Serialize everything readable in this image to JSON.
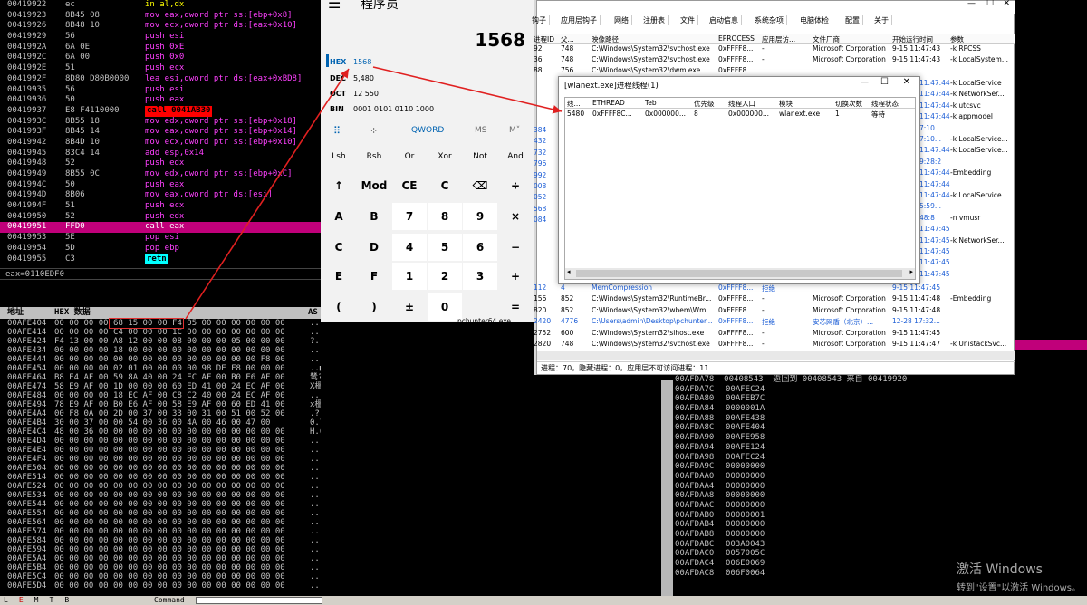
{
  "disasm": {
    "rows": [
      {
        "addr": "00419922",
        "hex": "ec",
        "mnem": "in al,dx",
        "color": "#ffff00"
      },
      {
        "addr": "00419923",
        "hex": "8B45 08",
        "mnem": "mov eax,dword ptr ss:[ebp+0x8]",
        "color": "#ff40ff"
      },
      {
        "addr": "00419926",
        "hex": "8B48 10",
        "mnem": "mov ecx,dword ptr ds:[eax+0x10]",
        "color": "#ff40ff"
      },
      {
        "addr": "00419929",
        "hex": "56",
        "mnem": "push esi",
        "color": "#ff40ff"
      },
      {
        "addr": "0041992A",
        "hex": "6A 0E",
        "mnem": "push 0xE",
        "color": "#ff40ff"
      },
      {
        "addr": "0041992C",
        "hex": "6A 00",
        "mnem": "push 0x0",
        "color": "#ff40ff"
      },
      {
        "addr": "0041992E",
        "hex": "51",
        "mnem": "push ecx",
        "color": "#ff40ff"
      },
      {
        "addr": "0041992F",
        "hex": "8D80 D80B0000",
        "mnem": "lea esi,dword ptr ds:[eax+0xBD8]",
        "color": "#ff40ff"
      },
      {
        "addr": "00419935",
        "hex": "56",
        "mnem": "push esi",
        "color": "#ff40ff"
      },
      {
        "addr": "00419936",
        "hex": "50",
        "mnem": "push eax",
        "color": "#ff40ff"
      },
      {
        "addr": "00419937",
        "hex": "E8 F4110000",
        "mnem": "call 0041AB30",
        "color": "#000000",
        "bg": "#ff0000"
      },
      {
        "addr": "0041993C",
        "hex": "8B55 18",
        "mnem": "mov edx,dword ptr ss:[ebp+0x18]",
        "color": "#ff40ff"
      },
      {
        "addr": "0041993F",
        "hex": "8B45 14",
        "mnem": "mov eax,dword ptr ss:[ebp+0x14]",
        "color": "#ff40ff"
      },
      {
        "addr": "00419942",
        "hex": "8B4D 10",
        "mnem": "mov ecx,dword ptr ss:[ebp+0x10]",
        "color": "#ff40ff"
      },
      {
        "addr": "00419945",
        "hex": "83C4 14",
        "mnem": "add esp,0x14",
        "color": "#ff40ff"
      },
      {
        "addr": "00419948",
        "hex": "52",
        "mnem": "push edx",
        "color": "#ff40ff"
      },
      {
        "addr": "00419949",
        "hex": "8B55 0C",
        "mnem": "mov edx,dword ptr ss:[ebp+0xC]",
        "color": "#ff40ff"
      },
      {
        "addr": "0041994C",
        "hex": "50",
        "mnem": "push eax",
        "color": "#ff40ff"
      },
      {
        "addr": "0041994D",
        "hex": "8B06",
        "mnem": "mov eax,dword ptr ds:[esi]",
        "color": "#ff40ff"
      },
      {
        "addr": "0041994F",
        "hex": "51",
        "mnem": "push ecx",
        "color": "#ff40ff"
      },
      {
        "addr": "00419950",
        "hex": "52",
        "mnem": "push edx",
        "color": "#ff40ff"
      },
      {
        "addr": "00419951",
        "hex": "FFD0",
        "mnem": "call eax",
        "color": "#ffffff",
        "sel": true
      },
      {
        "addr": "00419953",
        "hex": "5E",
        "mnem": "pop esi",
        "color": "#ff40ff"
      },
      {
        "addr": "00419954",
        "hex": "5D",
        "mnem": "pop ebp",
        "color": "#ff40ff"
      },
      {
        "addr": "00419955",
        "hex": "C3",
        "mnem": "retn",
        "color": "#000000",
        "bg": "#00ffff"
      }
    ],
    "info_line": "eax=0110EDF0"
  },
  "dump": {
    "header_addr": "地址",
    "header_hex": "HEX 数据",
    "header_ascii": "AS",
    "rows": [
      {
        "a": "00AFE404",
        "h": "00 00 00 00 68 15 00 00 F4 05 00 00 00 00 00 00",
        "s": "....h..?......."
      },
      {
        "a": "00AFE414",
        "h": "00 00 00 00 C4 00 00 00 1C 00 00 00 00 00 00 00",
        "s": "....?..■......."
      },
      {
        "a": "00AFE424",
        "h": "F4 13 00 00 A8 12 00 00 08 00 00 00 05 00 00 00",
        "s": "?..?..■....■..."
      },
      {
        "a": "00AFE434",
        "h": "00 00 00 00 18 00 00 00 00 00 00 00 00 00 00 00",
        "s": "................"
      },
      {
        "a": "00AFE444",
        "h": "00 00 00 00 00 00 00 00 00 00 00 00 00 00 F8 00",
        "s": "..............?."
      },
      {
        "a": "00AFE454",
        "h": "00 00 00 00 02 01 00 00 00 00 98 DE F8 00 00 00",
        "s": "..■■...?掠?...."
      },
      {
        "a": "00AFE464",
        "h": "B8 E4 AF 00 59 8A 40 00 24 EC AF 00 B0 E6 AF 00",
        "s": "鸶?Y奅.$.辽.版?"
      },
      {
        "a": "00AFE474",
        "h": "58 E9 AF 00 1D 00 00 00 60 ED 41 00 24 EC AF 00",
        "s": "X楹.■...`鞉.$.?"
      },
      {
        "a": "00AFE484",
        "h": "00 00 00 00 18 EC AF 00 C8 C2 40 00 24 EC AF 00",
        "s": "....■.?蚂@.$.?"
      },
      {
        "a": "00AFE494",
        "h": "78 E9 AF 00 B0 E6 AF 00 58 E9 AF 00 60 ED 41 00",
        "s": "x楹.版?X楹.`鞉."
      },
      {
        "a": "00AFE4A4",
        "h": "00 F8 0A 00 2D 00 37 00 33 00 31 00 51 00 52 00",
        "s": ".?..-.7.3.1.Q.R."
      },
      {
        "a": "00AFE4B4",
        "h": "30 00 37 00 00 54 00 36 00 4A 00 46 00 47 00",
        "s": "0.7...T.6.J.F.G."
      },
      {
        "a": "00AFE4C4",
        "h": "48 00 36 00 00 00 00 00 00 00 00 00 00 00 00 00",
        "s": "H.6............."
      },
      {
        "a": "00AFE4D4",
        "h": "00 00 00 00 00 00 00 00 00 00 00 00 00 00 00 00",
        "s": "................"
      },
      {
        "a": "00AFE4E4",
        "h": "00 00 00 00 00 00 00 00 00 00 00 00 00 00 00 00",
        "s": "................"
      },
      {
        "a": "00AFE4F4",
        "h": "00 00 00 00 00 00 00 00 00 00 00 00 00 00 00 00",
        "s": "................"
      },
      {
        "a": "00AFE504",
        "h": "00 00 00 00 00 00 00 00 00 00 00 00 00 00 00 00",
        "s": "................"
      },
      {
        "a": "00AFE514",
        "h": "00 00 00 00 00 00 00 00 00 00 00 00 00 00 00 00",
        "s": "................"
      },
      {
        "a": "00AFE524",
        "h": "00 00 00 00 00 00 00 00 00 00 00 00 00 00 00 00",
        "s": "................"
      },
      {
        "a": "00AFE534",
        "h": "00 00 00 00 00 00 00 00 00 00 00 00 00 00 00 00",
        "s": "................"
      },
      {
        "a": "00AFE544",
        "h": "00 00 00 00 00 00 00 00 00 00 00 00 00 00 00 00",
        "s": "................"
      },
      {
        "a": "00AFE554",
        "h": "00 00 00 00 00 00 00 00 00 00 00 00 00 00 00 00",
        "s": "................"
      },
      {
        "a": "00AFE564",
        "h": "00 00 00 00 00 00 00 00 00 00 00 00 00 00 00 00",
        "s": "................"
      },
      {
        "a": "00AFE574",
        "h": "00 00 00 00 00 00 00 00 00 00 00 00 00 00 00 00",
        "s": "................"
      },
      {
        "a": "00AFE584",
        "h": "00 00 00 00 00 00 00 00 00 00 00 00 00 00 00 00",
        "s": "................"
      },
      {
        "a": "00AFE594",
        "h": "00 00 00 00 00 00 00 00 00 00 00 00 00 00 00 00",
        "s": "................"
      },
      {
        "a": "00AFE5A4",
        "h": "00 00 00 00 00 00 00 00 00 00 00 00 00 00 00 00",
        "s": "................"
      },
      {
        "a": "00AFE5B4",
        "h": "00 00 00 00 00 00 00 00 00 00 00 00 00 00 00 00",
        "s": "................"
      },
      {
        "a": "00AFE5C4",
        "h": "00 00 00 00 00 00 00 00 00 00 00 00 00 00 00 00",
        "s": "................"
      },
      {
        "a": "00AFE5D4",
        "h": "00 00 00 00 00 00 00 00 00 00 00 00 00 00 00 00",
        "s": "................"
      }
    ]
  },
  "stack": {
    "top_line": "00AFDA78  00408543  返回到 00408543 来自 00419920",
    "rows": [
      {
        "a": "00AFDA7C",
        "v": "00AFEC24"
      },
      {
        "a": "00AFDA80",
        "v": "00AFEB7C"
      },
      {
        "a": "00AFDA84",
        "v": "0000001A"
      },
      {
        "a": "00AFDA88",
        "v": "00AFE438"
      },
      {
        "a": "00AFDA8C",
        "v": "00AFE404"
      },
      {
        "a": "00AFDA90",
        "v": "00AFE958"
      },
      {
        "a": "00AFDA94",
        "v": "00AFE124"
      },
      {
        "a": "00AFDA98",
        "v": "00AFEC24"
      },
      {
        "a": "00AFDA9C",
        "v": "00000000"
      },
      {
        "a": "00AFDAA0",
        "v": "00000000"
      },
      {
        "a": "00AFDAA4",
        "v": "00000000"
      },
      {
        "a": "00AFDAA8",
        "v": "00000000"
      },
      {
        "a": "00AFDAAC",
        "v": "00000000"
      },
      {
        "a": "00AFDAB0",
        "v": "00000001"
      },
      {
        "a": "00AFDAB4",
        "v": "00000000"
      },
      {
        "a": "00AFDAB8",
        "v": "00000000"
      },
      {
        "a": "00AFDABC",
        "v": "003A0043"
      },
      {
        "a": "00AFDAC0",
        "v": "0057005C"
      },
      {
        "a": "00AFDAC4",
        "v": "006E0069"
      },
      {
        "a": "00AFDAC8",
        "v": "006F0064"
      }
    ]
  },
  "calculator": {
    "title": "程序员",
    "display": "1568",
    "hex_label": "HEX",
    "hex_value": "1568",
    "dec_label": "DEC",
    "dec_value": "5,480",
    "oct_label": "OCT",
    "oct_value": "12 550",
    "bin_label": "BIN",
    "bin_value": "0001 0101 0110 1000",
    "word_size": "QWORD",
    "ms": "MS",
    "mm": "M˅",
    "row1": [
      "Lsh",
      "Rsh",
      "Or",
      "Xor",
      "Not",
      "And"
    ],
    "row2": [
      "↑",
      "Mod",
      "CE",
      "C",
      "⌫",
      "÷"
    ],
    "row3": [
      "A",
      "B",
      "7",
      "8",
      "9",
      "×"
    ],
    "row4": [
      "C",
      "D",
      "4",
      "5",
      "6",
      "−"
    ],
    "row5": [
      "E",
      "F",
      "1",
      "2",
      "3",
      "+"
    ],
    "row6": [
      "(",
      ")",
      "±",
      "0",
      "="
    ]
  },
  "process_manager": {
    "tabs": [
      "钩子",
      "应用层钩子",
      "网络",
      "注册表",
      "文件",
      "启动信息",
      "系统杂项",
      "电脑体检",
      "配置",
      "关于"
    ],
    "columns": [
      "进程ID",
      "父...",
      "映像路径",
      "EPROCESS",
      "应用层访...",
      "文件厂商",
      "开始运行时间",
      "参数"
    ],
    "rows": [
      {
        "pid": "92",
        "ppid": "748",
        "path": "C:\\Windows\\System32\\svchost.exe",
        "ep": "0xFFFF8...",
        "acc": "-",
        "vendor": "Microsoft Corporation",
        "time": "9-15 11:47:43",
        "arg": "-k RPCSS"
      },
      {
        "pid": "36",
        "ppid": "748",
        "path": "C:\\Windows\\System32\\svchost.exe",
        "ep": "0xFFFF8...",
        "acc": "-",
        "vendor": "Microsoft Corporation",
        "time": "9-15 11:47:43",
        "arg": "-k LocalSystem..."
      },
      {
        "pid": "88",
        "ppid": "756",
        "path": "C:\\Windows\\System32\\dwm.exe",
        "ep": "0xFFFF8...",
        "acc": "",
        "vendor": "",
        "time": "",
        "arg": ""
      }
    ],
    "lower_rows": [
      {
        "pid": "112",
        "ppid": "4",
        "path": "MemCompression",
        "ep": "0xFFFF8...",
        "acc": "拒绝",
        "vendor": "",
        "time": "9-15 11:47:45",
        "arg": "",
        "blue": true
      },
      {
        "name": "",
        "pid": "156",
        "ppid": "852",
        "path": "C:\\Windows\\System32\\RuntimeBr...",
        "ep": "0xFFFF8...",
        "acc": "-",
        "vendor": "Microsoft Corporation",
        "time": "9-15 11:47:48",
        "arg": "-Embedding"
      },
      {
        "name": "",
        "pid": "820",
        "ppid": "852",
        "path": "C:\\Windows\\System32\\wbem\\Wmi...",
        "ep": "0xFFFF8...",
        "acc": "-",
        "vendor": "Microsoft Corporation",
        "time": "9-15 11:47:48",
        "arg": ""
      },
      {
        "name": "pchunter64.exe",
        "pid": "2420",
        "ppid": "4776",
        "path": "C:\\Users\\admin\\Desktop\\pchunter...",
        "ep": "0xFFFF8...",
        "acc": "拒绝",
        "vendor": "安芯网盾（北京）...",
        "time": "12-28 17:32...",
        "arg": "",
        "blue": true
      },
      {
        "name": "sihost.exe",
        "pid": "2752",
        "ppid": "600",
        "path": "C:\\Windows\\System32\\sihost.exe",
        "ep": "0xFFFF8...",
        "acc": "-",
        "vendor": "Microsoft Corporation",
        "time": "9-15 11:47:45",
        "arg": ""
      },
      {
        "name": "svchost.exe",
        "pid": "2820",
        "ppid": "748",
        "path": "C:\\Windows\\System32\\svchost.exe",
        "ep": "0xFFFF8...",
        "acc": "-",
        "vendor": "Microsoft Corporation",
        "time": "9-15 11:47:47",
        "arg": "-k UnistackSvc..."
      }
    ],
    "side_rows": [
      {
        "time": "11:47:44",
        "arg": "-k LocalService"
      },
      {
        "time": "11:47:44",
        "arg": "-k NetworkSer..."
      },
      {
        "time": "11:47:44",
        "arg": "-k utcsvc"
      },
      {
        "time": "11:47:44",
        "arg": "-k appmodel"
      },
      {
        "time": "7:10...",
        "arg": ""
      },
      {
        "time": "7:10...",
        "arg": "-k LocalService..."
      },
      {
        "time": "11:47:44",
        "arg": "-k LocalService..."
      },
      {
        "time": "9:28:2",
        "arg": ""
      },
      {
        "time": "11:47:44",
        "arg": "-Embedding"
      },
      {
        "time": "11:47:44",
        "arg": ""
      },
      {
        "time": "11:47:44",
        "arg": "-k LocalService"
      },
      {
        "time": "5:59...",
        "arg": ""
      },
      {
        "time": "48:8",
        "arg": "-n vmusr"
      },
      {
        "time": "11:47:45",
        "arg": ""
      },
      {
        "time": "11:47:45",
        "arg": "-k NetworkSer..."
      },
      {
        "time": "11:47:45",
        "arg": ""
      },
      {
        "time": "11:47:45",
        "arg": ""
      },
      {
        "time": "11:47:45",
        "arg": ""
      }
    ],
    "blue_pids": [
      "384",
      "432",
      "732",
      "796",
      "992",
      "008",
      "052",
      "568",
      "084"
    ],
    "status": "进程：70，隐藏进程：0，应用层不可访问进程：11"
  },
  "thread_window": {
    "title": "[wlanext.exe]进程线程(1)",
    "columns": [
      "线...",
      "ETHREAD",
      "Teb",
      "优先级",
      "线程入口",
      "模块",
      "切换次数",
      "线程状态"
    ],
    "row": {
      "tid": "5480",
      "ethread": "0xFFFF8C...",
      "teb": "0x000000...",
      "prio": "8",
      "entry": "0x000000...",
      "module": "wlanext.exe",
      "switches": "1",
      "state": "等待"
    }
  },
  "bottom": {
    "labels": [
      "L",
      "E",
      "M",
      "T",
      "B"
    ],
    "cmd": "Command"
  },
  "watermark": {
    "line1": "激活 Windows",
    "line2": "转到\"设置\"以激活 Windows。"
  }
}
